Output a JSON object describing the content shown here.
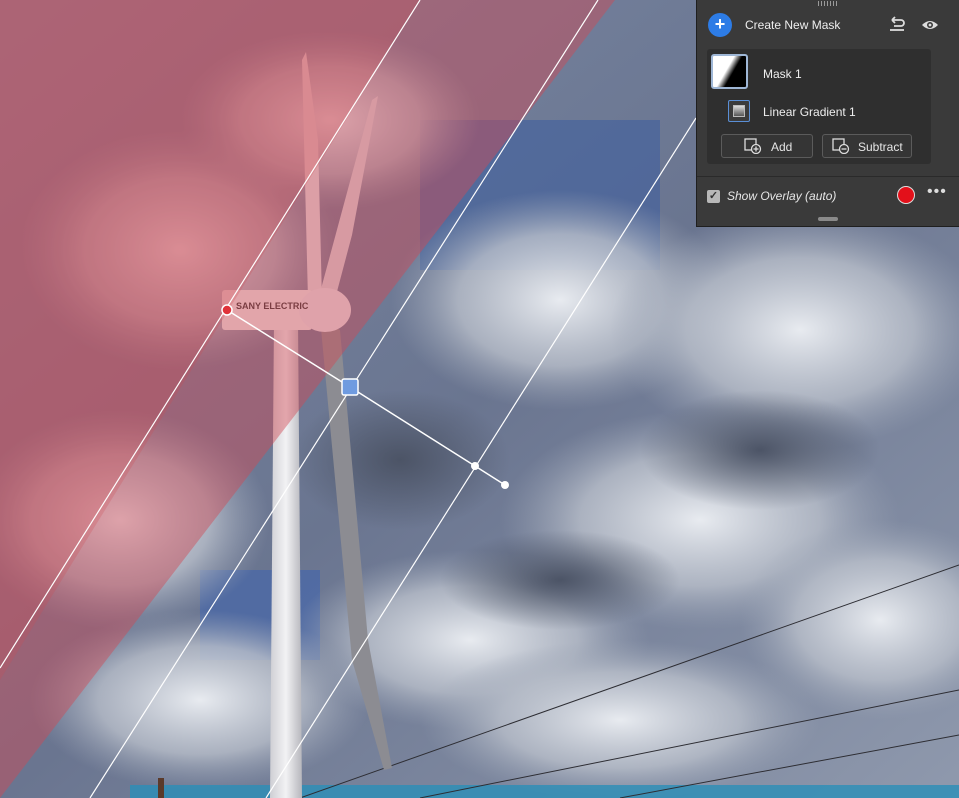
{
  "panel": {
    "title": "Create New Mask",
    "add_icon": "plus-icon",
    "reset_icon": "undo-icon",
    "visibility_icon": "eye-icon",
    "mask": {
      "name": "Mask 1"
    },
    "component": {
      "name": "Linear Gradient 1",
      "icon": "linear-gradient-icon"
    },
    "buttons": {
      "add": "Add",
      "subtract": "Subtract"
    },
    "overlay": {
      "label": "Show Overlay (auto)",
      "checked": true,
      "color": "#e3101a"
    },
    "more_icon": "ellipsis-icon"
  },
  "canvas": {
    "turbine_label": "SANY ELECTRIC",
    "overlay_color": "#d9555f"
  }
}
